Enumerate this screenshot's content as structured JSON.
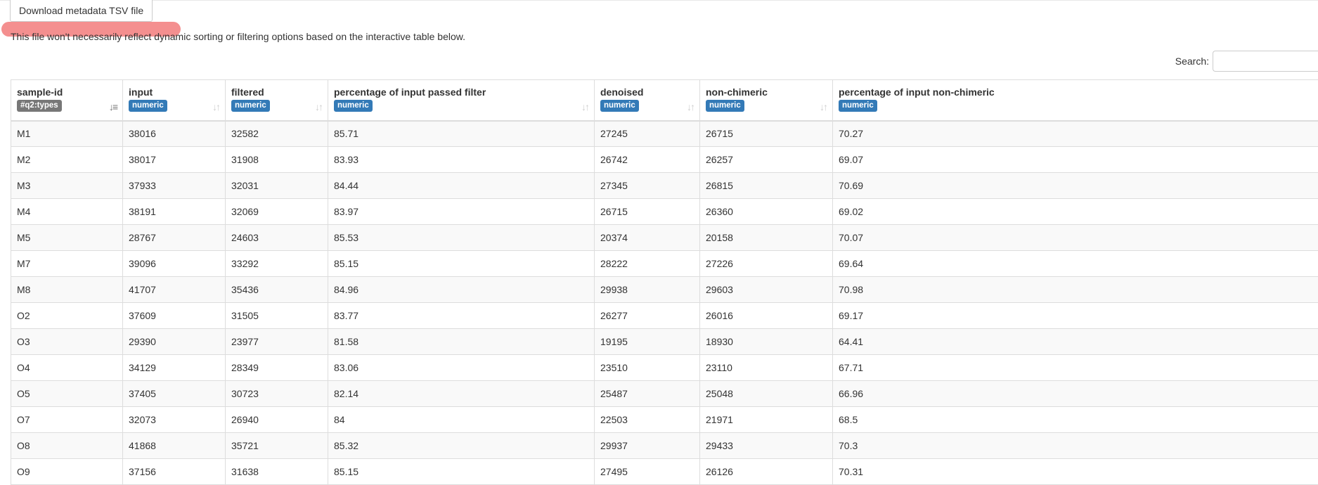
{
  "download_button": {
    "label": "Download metadata TSV file"
  },
  "note": "This file won't necessarily reflect dynamic sorting or filtering options based on the interactive table below.",
  "search": {
    "label": "Search:",
    "value": ""
  },
  "colors": {
    "id_badge": "#777777",
    "numeric_badge": "#337ab7",
    "highlight_stroke": "#f27b7b"
  },
  "table": {
    "columns": [
      {
        "name": "sample-id",
        "type": "#q2:types",
        "sort_icon": "sort-amount-asc-icon",
        "sorted": true
      },
      {
        "name": "input",
        "type": "numeric",
        "sort_icon": "sort-both-icon",
        "sorted": false
      },
      {
        "name": "filtered",
        "type": "numeric",
        "sort_icon": "sort-both-icon",
        "sorted": false
      },
      {
        "name": "percentage of input passed filter",
        "type": "numeric",
        "sort_icon": "sort-both-icon",
        "sorted": false
      },
      {
        "name": "denoised",
        "type": "numeric",
        "sort_icon": "sort-both-icon",
        "sorted": false
      },
      {
        "name": "non-chimeric",
        "type": "numeric",
        "sort_icon": "sort-both-icon",
        "sorted": false
      },
      {
        "name": "percentage of input non-chimeric",
        "type": "numeric",
        "sort_icon": "sort-both-icon",
        "sorted": false
      }
    ],
    "rows": [
      [
        "M1",
        "38016",
        "32582",
        "85.71",
        "27245",
        "26715",
        "70.27"
      ],
      [
        "M2",
        "38017",
        "31908",
        "83.93",
        "26742",
        "26257",
        "69.07"
      ],
      [
        "M3",
        "37933",
        "32031",
        "84.44",
        "27345",
        "26815",
        "70.69"
      ],
      [
        "M4",
        "38191",
        "32069",
        "83.97",
        "26715",
        "26360",
        "69.02"
      ],
      [
        "M5",
        "28767",
        "24603",
        "85.53",
        "20374",
        "20158",
        "70.07"
      ],
      [
        "M7",
        "39096",
        "33292",
        "85.15",
        "28222",
        "27226",
        "69.64"
      ],
      [
        "M8",
        "41707",
        "35436",
        "84.96",
        "29938",
        "29603",
        "70.98"
      ],
      [
        "O2",
        "37609",
        "31505",
        "83.77",
        "26277",
        "26016",
        "69.17"
      ],
      [
        "O3",
        "29390",
        "23977",
        "81.58",
        "19195",
        "18930",
        "64.41"
      ],
      [
        "O4",
        "34129",
        "28349",
        "83.06",
        "23510",
        "23110",
        "67.71"
      ],
      [
        "O5",
        "37405",
        "30723",
        "82.14",
        "25487",
        "25048",
        "66.96"
      ],
      [
        "O7",
        "32073",
        "26940",
        "84",
        "22503",
        "21971",
        "68.5"
      ],
      [
        "O8",
        "41868",
        "35721",
        "85.32",
        "29937",
        "29433",
        "70.3"
      ],
      [
        "O9",
        "37156",
        "31638",
        "85.15",
        "27495",
        "26126",
        "70.31"
      ]
    ]
  }
}
